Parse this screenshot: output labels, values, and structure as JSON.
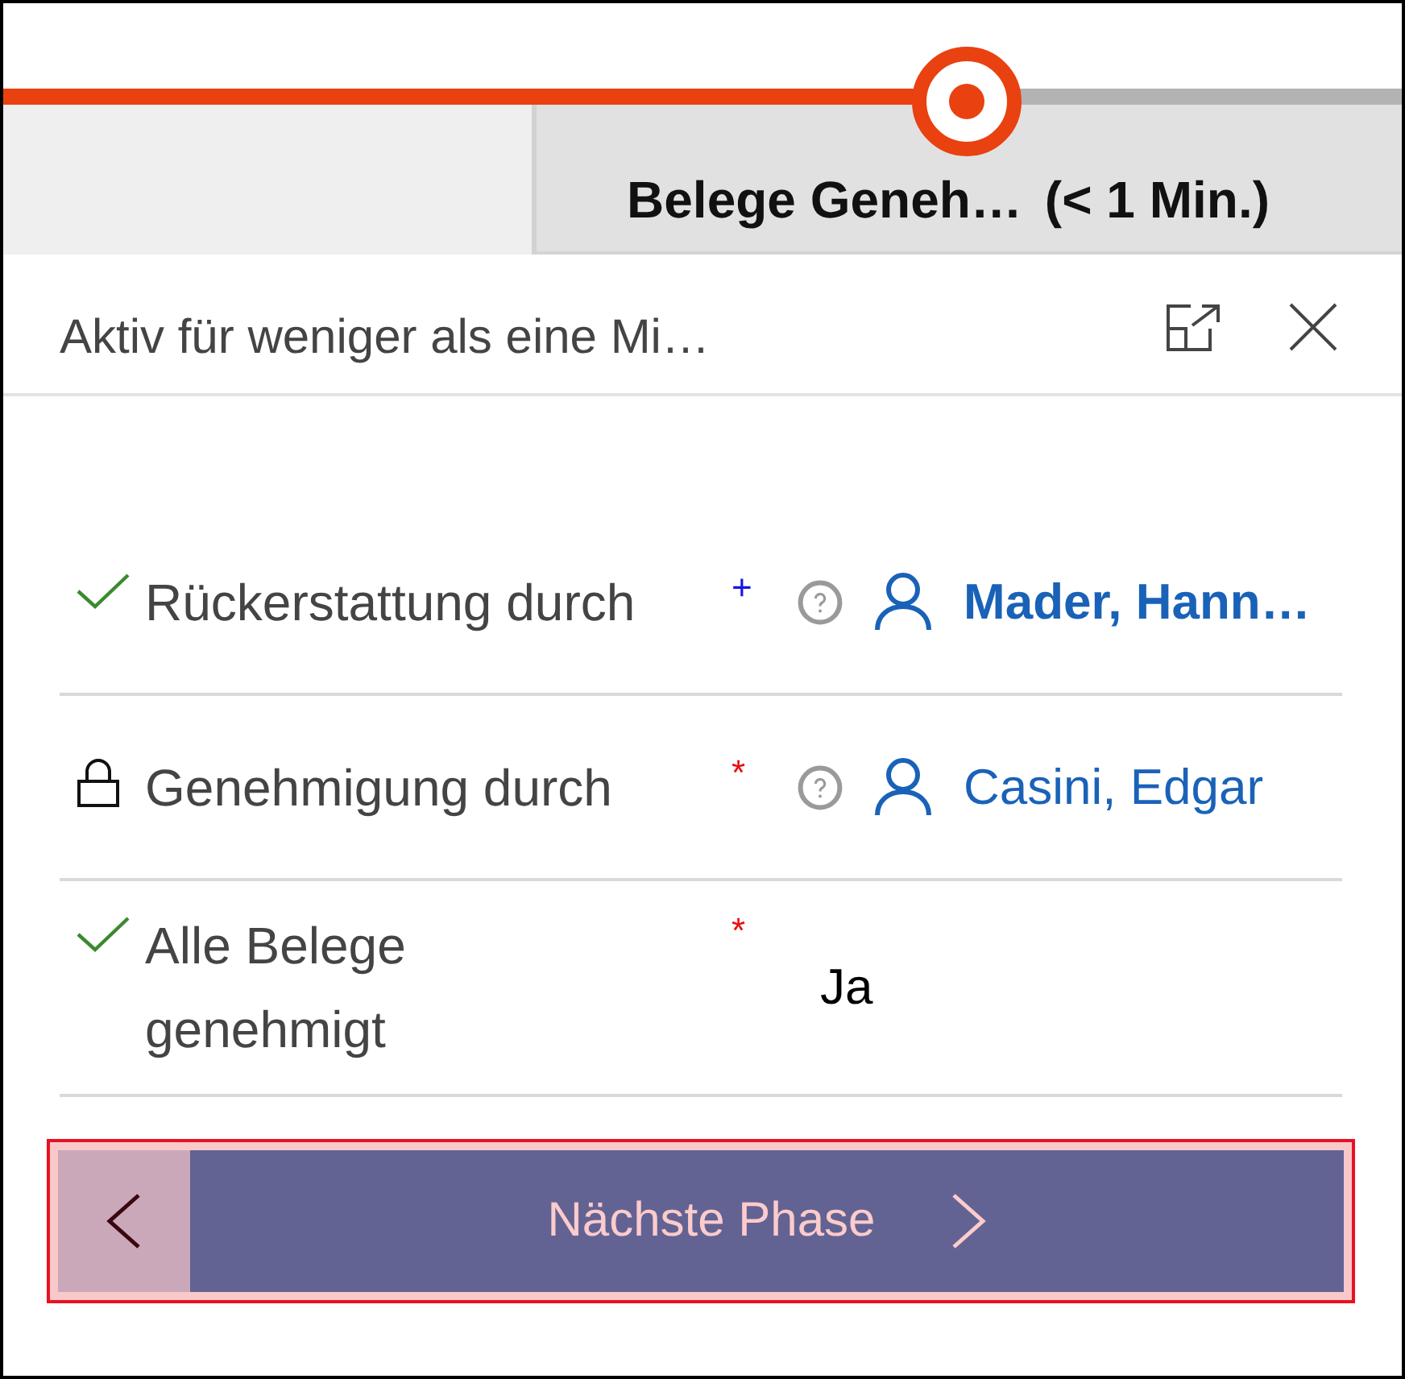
{
  "stages": [
    {
      "selected": false
    },
    {
      "name": "Belege Geneh…",
      "duration": "(< 1 Min.)",
      "selected": true
    }
  ],
  "flyout": {
    "status": "Aktiv für weniger als eine Mi…"
  },
  "fields": [
    {
      "kind": "lookup",
      "completed": true,
      "locked": false,
      "label": "Rückerstattung durch",
      "required": false,
      "mark": "+",
      "value": "Mader, Hann…",
      "highlighted": true
    },
    {
      "kind": "lookup",
      "completed": false,
      "locked": true,
      "label": "Genehmigung durch",
      "required": true,
      "mark": "*",
      "value": "Casini, Edgar",
      "highlighted": false
    },
    {
      "kind": "text",
      "completed": true,
      "locked": false,
      "label": "Alle Belege genehmigt",
      "required": true,
      "mark": "*",
      "value": "Ja"
    }
  ],
  "navigation": {
    "focused": true,
    "next_label": "Nächste Phase"
  }
}
